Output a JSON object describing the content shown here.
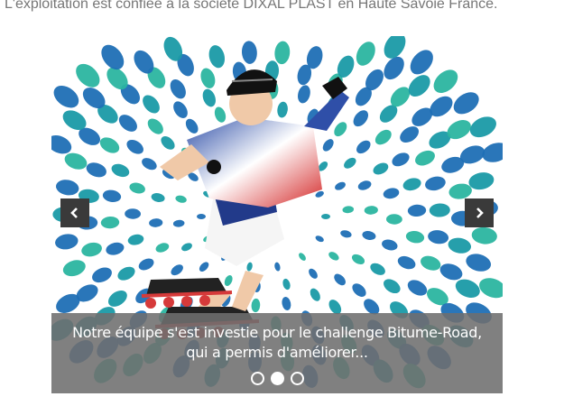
{
  "intro": {
    "text": "L'exploitation est confiée  à la société DIXAL PLAST  en  Haute Savoie France."
  },
  "slider": {
    "caption": "Notre équipe s'est investie pour le challenge Bitume-Road, qui a permis d'améliorer...",
    "dot_count": 3,
    "active_index": 1,
    "prev_icon": "chevron-left-icon",
    "next_icon": "chevron-right-icon",
    "colors": {
      "teal": "#1a9aa6",
      "blue": "#1f6fb5",
      "green": "#2bb5a0",
      "navigation": "#3a3a3a"
    }
  }
}
